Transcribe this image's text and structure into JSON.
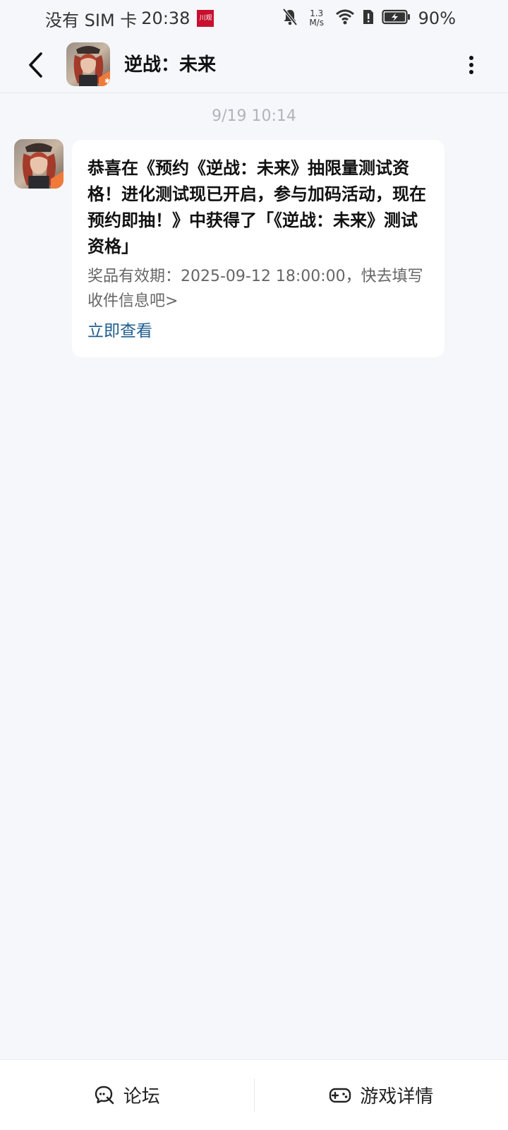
{
  "status_bar": {
    "carrier": "没有 SIM 卡",
    "time": "20:38",
    "badge_text": "川观",
    "net_speed_value": "1.3",
    "net_speed_unit": "M/s",
    "battery": "90%",
    "icons": [
      "bell-off-icon",
      "wifi-icon",
      "sim-alert-icon",
      "battery-charging-icon"
    ]
  },
  "header": {
    "title": "逆战：未来",
    "back_icon": "chevron-left-icon",
    "more_icon": "more-vertical-icon"
  },
  "conversation": {
    "timestamp": "9/19  10:14",
    "message": {
      "title": "恭喜在《预约《逆战：未来》抽限量测试资格！进化测试现已开启，参与加码活动，现在预约即抽！》中获得了「《逆战：未来》测试资格」",
      "subtitle": "奖品有效期：2025-09-12 18:00:00，快去填写收件信息吧>",
      "action": "立即查看"
    }
  },
  "bottom_bar": {
    "forum_label": "论坛",
    "forum_icon": "forum-chat-icon",
    "details_label": "游戏详情",
    "details_icon": "gamepad-icon"
  },
  "colors": {
    "background": "#f5f7fa",
    "link": "#1f5d8f",
    "badge": "#c8102e"
  }
}
